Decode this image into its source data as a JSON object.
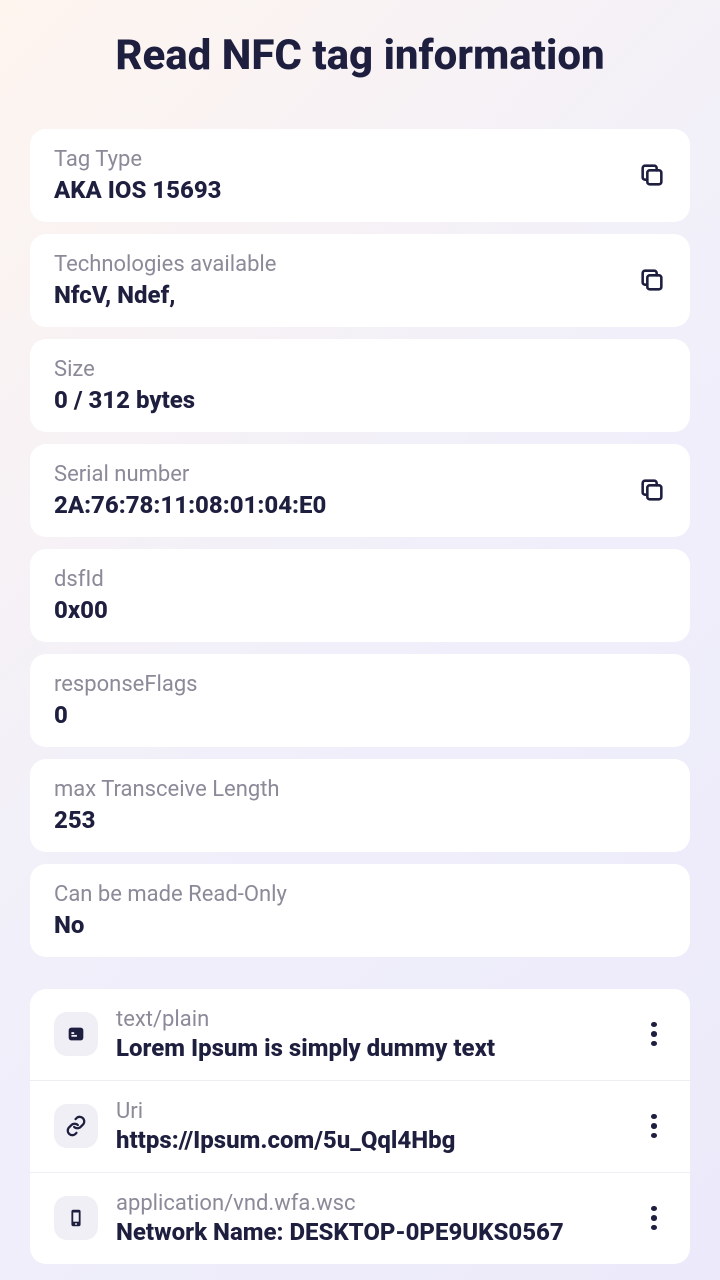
{
  "title": "Read NFC tag information",
  "info": [
    {
      "label": "Tag Type",
      "value": "AKA IOS 15693",
      "copy": true
    },
    {
      "label": "Technologies available",
      "value": "NfcV, Ndef,",
      "copy": true
    },
    {
      "label": "Size",
      "value": "0 / 312 bytes",
      "copy": false
    },
    {
      "label": "Serial number",
      "value": "2A:76:78:11:08:01:04:E0",
      "copy": true
    },
    {
      "label": "dsfId",
      "value": "0x00",
      "copy": false
    },
    {
      "label": "responseFlags",
      "value": "0",
      "copy": false
    },
    {
      "label": "max Transceive Length",
      "value": "253",
      "copy": false
    },
    {
      "label": "Can be made Read-Only",
      "value": "No",
      "copy": false
    }
  ],
  "records": [
    {
      "type": "text/plain",
      "value": "Lorem Ipsum is simply dummy text",
      "icon": "text"
    },
    {
      "type": "Uri",
      "value": "https://Ipsum.com/5u_Qql4Hbg",
      "icon": "link"
    },
    {
      "type": "application/vnd.wfa.wsc",
      "value": "Network Name: DESKTOP-0PE9UKS0567",
      "icon": "device"
    }
  ]
}
